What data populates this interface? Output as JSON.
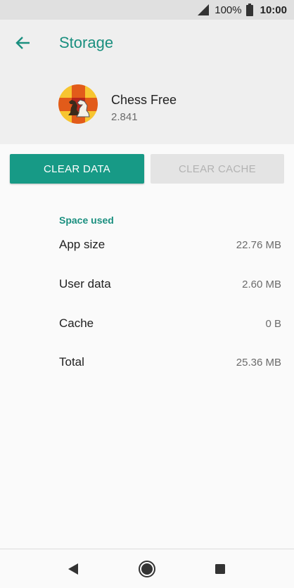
{
  "status_bar": {
    "battery_percent": "100%",
    "time": "10:00",
    "icons": [
      "signal-icon",
      "battery-icon"
    ]
  },
  "header": {
    "title": "Storage",
    "back_icon": "arrow-left-icon"
  },
  "app": {
    "name": "Chess Free",
    "version": "2.841",
    "icon": "chess-knight-icon"
  },
  "buttons": {
    "clear_data": "CLEAR DATA",
    "clear_cache": "CLEAR CACHE"
  },
  "storage": {
    "section_label": "Space used",
    "rows": [
      {
        "label": "App size",
        "value": "22.76 MB"
      },
      {
        "label": "User data",
        "value": "2.60 MB"
      },
      {
        "label": "Cache",
        "value": "0 B"
      },
      {
        "label": "Total",
        "value": "25.36 MB"
      }
    ]
  },
  "nav_bar": {
    "icons": [
      "back-triangle-icon",
      "home-circle-icon",
      "recents-square-icon"
    ]
  },
  "colors": {
    "accent": "#1a8f7f",
    "button_primary": "#179a86",
    "button_disabled_bg": "#e4e4e4",
    "button_disabled_text": "#b3b3b3"
  }
}
